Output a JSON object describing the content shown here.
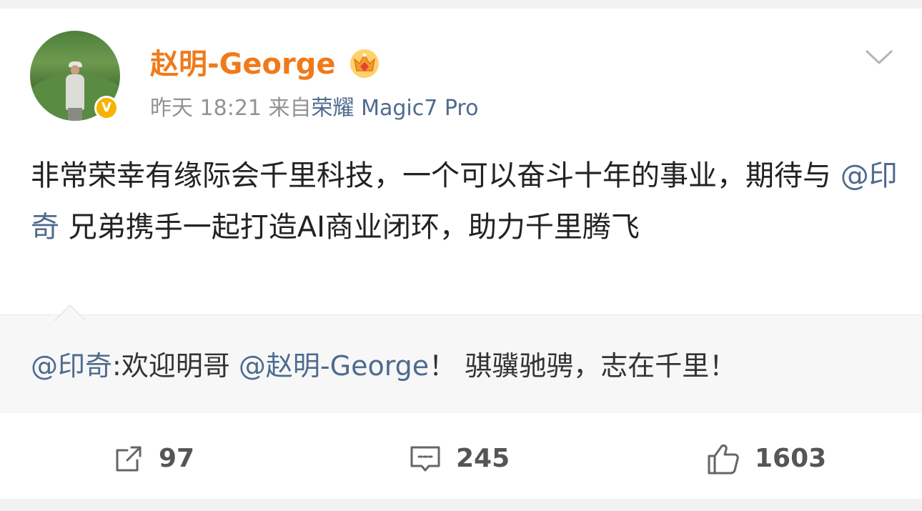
{
  "post": {
    "author": "赵明-George",
    "time": "昨天 18:21",
    "source_prefix": "来自",
    "source_device": "荣耀 Magic7 Pro",
    "body_part1": "非常荣幸有缘际会千里科技，一个可以奋斗十年的事业，期待与 ",
    "body_mention": "@印奇",
    "body_part2": " 兄弟携手一起打造AI商业闭环，助力千里腾飞"
  },
  "repost": {
    "mention1": "@印奇",
    "text1": ":欢迎明哥 ",
    "mention2": "@赵明-George",
    "text2": "！ 骐骥驰骋，志在千里！"
  },
  "actions": {
    "repost_count": "97",
    "comment_count": "245",
    "like_count": "1603"
  },
  "colors": {
    "username": "#f07a1a",
    "link": "#4e6b8e",
    "verified_badge": "#f6b400"
  },
  "icons": {
    "verified": "verified-v-icon",
    "vip": "crown-icon",
    "menu": "chevron-down-icon",
    "repost": "repost-icon",
    "comment": "comment-icon",
    "like": "thumbs-up-icon"
  }
}
